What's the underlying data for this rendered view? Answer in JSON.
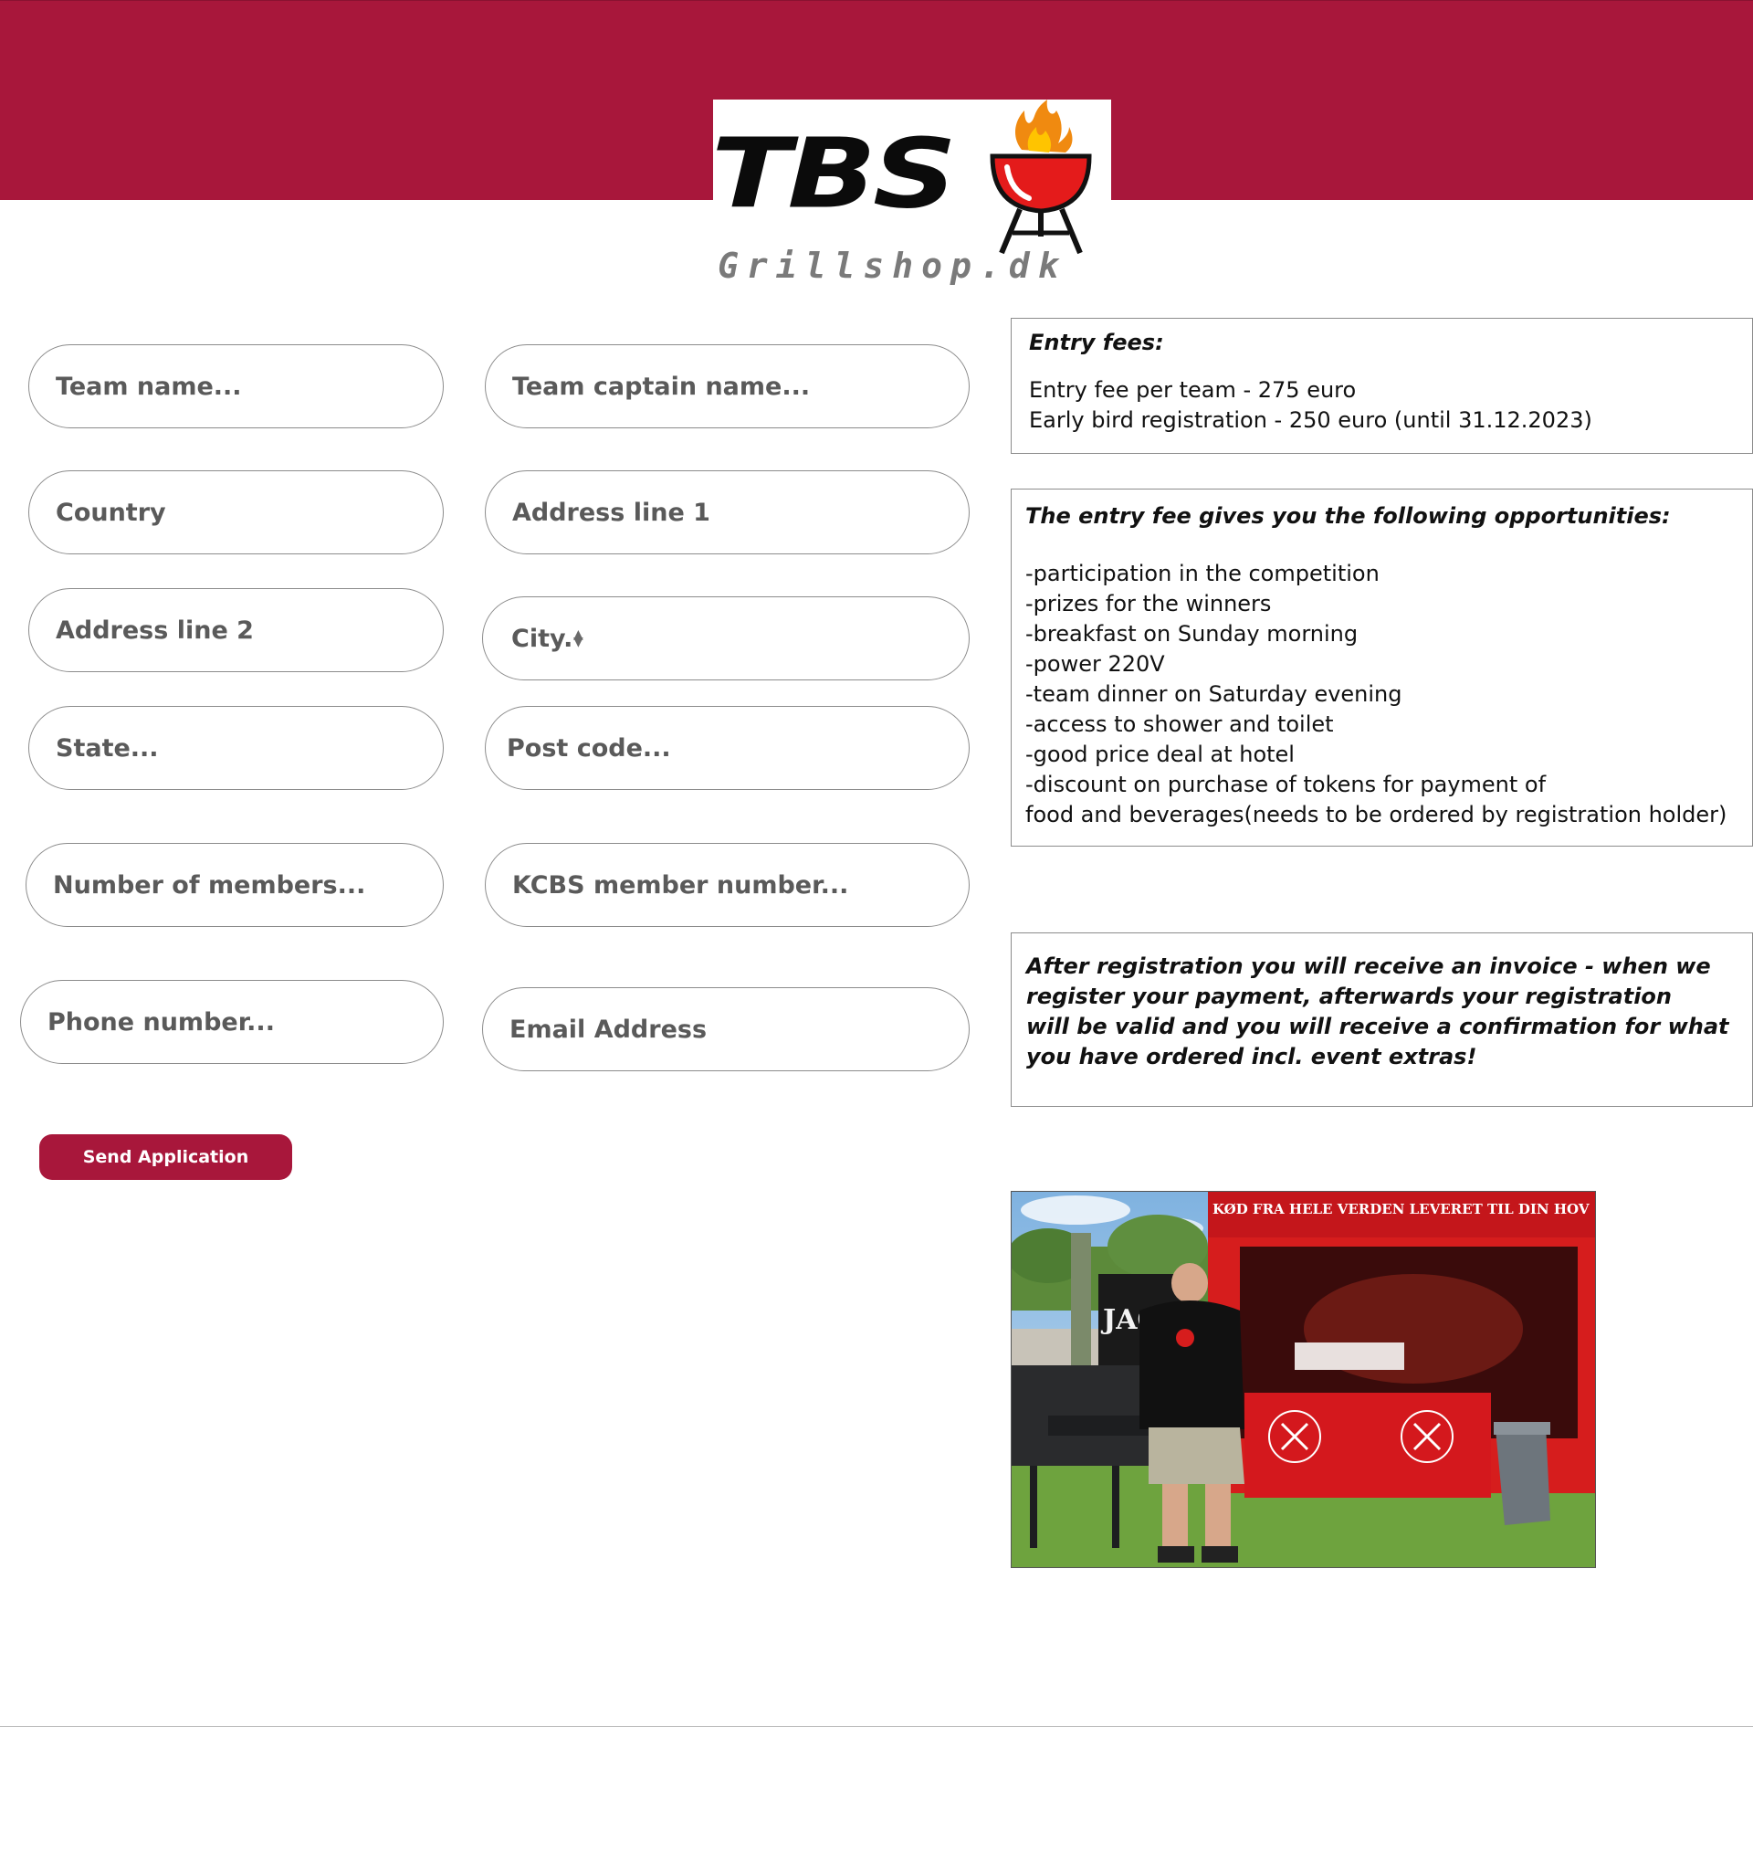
{
  "logo": {
    "brand": "TBS",
    "subtitle": "Grillshop.dk"
  },
  "form": {
    "fields": [
      {
        "name": "team-name-input",
        "placeholder": "Team name..."
      },
      {
        "name": "team-captain-input",
        "placeholder": "Team captain name..."
      },
      {
        "name": "country-input",
        "placeholder": "Country"
      },
      {
        "name": "address-line-1-input",
        "placeholder": "Address line 1"
      },
      {
        "name": "address-line-2-input",
        "placeholder": "Address line 2"
      },
      {
        "name": "city-input",
        "placeholder": "City.."
      },
      {
        "name": "state-input",
        "placeholder": "State..."
      },
      {
        "name": "post-code-input",
        "placeholder": "Post code..."
      },
      {
        "name": "number-of-members-input",
        "placeholder": "Number of members..."
      },
      {
        "name": "kcbs-member-number-input",
        "placeholder": "KCBS member number..."
      },
      {
        "name": "phone-number-input",
        "placeholder": "Phone number..."
      },
      {
        "name": "email-address-input",
        "placeholder": "Email Address"
      }
    ],
    "submit_label": "Send Application"
  },
  "entry_fees": {
    "title": "Entry fees:",
    "lines": [
      "Entry fee per team - 275 euro",
      "Early bird registration - 250 euro (until 31.12.2023)"
    ]
  },
  "opportunities": {
    "title": "The entry fee gives you the following opportunities:",
    "lines": [
      "-participation in the competition",
      "-prizes for the winners",
      "-breakfast on Sunday morning",
      "-power 220V",
      "-team dinner on Saturday evening",
      "-access to shower and toilet",
      "-good price deal at hotel",
      "-discount on purchase of tokens for payment of",
      "food and beverages(needs to be ordered by registration holder)"
    ]
  },
  "notice": {
    "lines": [
      "After registration you will receive an invoice - when we",
      "register your payment, afterwards your registration",
      "will be valid and you will receive a confirmation for what",
      "you have ordered incl. event extras!"
    ]
  },
  "photo": {
    "banner": "KØD FRA HELE VERDEN LEVERET TIL DIN HOV",
    "sign": "JACK DA"
  }
}
